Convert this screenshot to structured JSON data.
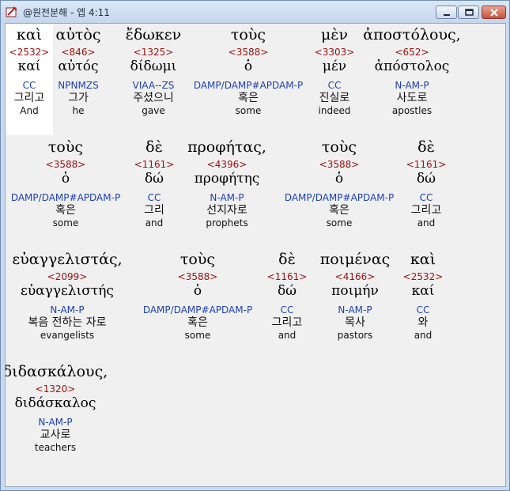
{
  "window": {
    "title": "@원전분해 - 엡 4:11",
    "colors": {
      "strong": "#a01010",
      "parse": "#1f3fb8",
      "highlight": "#ffffff"
    }
  },
  "rows": [
    {
      "words": [
        {
          "greek": "καὶ",
          "strong": "<2532>",
          "lemma": "καί",
          "parse": "CC",
          "korean": "그리고",
          "english": "And",
          "highlight": true
        },
        {
          "greek": "αὐτὸς",
          "strong": "<846>",
          "lemma": "αὐτός",
          "parse": "NPNMZS",
          "korean": "그가",
          "english": "he"
        },
        {
          "greek": "ἔδωκεν",
          "strong": "<1325>",
          "lemma": "δίδωμι",
          "parse": "VIAA--ZS",
          "korean": "주셨으니",
          "english": "gave"
        },
        {
          "greek": "τοὺς",
          "strong": "<3588>",
          "lemma": "ὁ",
          "parse": "DAMP/DAMP#APDAM-P",
          "korean": "혹은",
          "english": "some"
        },
        {
          "greek": "μὲν",
          "strong": "<3303>",
          "lemma": "μέν",
          "parse": "CC",
          "korean": "진실로",
          "english": "indeed"
        },
        {
          "greek": "ἀποστόλους,",
          "strong": "<652>",
          "lemma": "ἀπόστολος",
          "parse": "N-AM-P",
          "korean": "사도로",
          "english": "apostles"
        }
      ]
    },
    {
      "words": [
        {
          "greek": "τοὺς",
          "strong": "<3588>",
          "lemma": "ὁ",
          "parse": "DAMP/DAMP#APDAM-P",
          "korean": "혹은",
          "english": "some"
        },
        {
          "greek": "δὲ",
          "strong": "<1161>",
          "lemma": "δώ",
          "parse": "CC",
          "korean": "그리",
          "english": "and"
        },
        {
          "greek": "προφήτας,",
          "strong": "<4396>",
          "lemma": "προφήτης",
          "parse": "N-AM-P",
          "korean": "선지자로",
          "english": "prophets"
        },
        {
          "greek": "τοὺς",
          "strong": "<3588>",
          "lemma": "ὁ",
          "parse": "DAMP/DAMP#APDAM-P",
          "korean": "혹은",
          "english": "some"
        },
        {
          "greek": "δὲ",
          "strong": "<1161>",
          "lemma": "δώ",
          "parse": "CC",
          "korean": "그리고",
          "english": "and"
        }
      ]
    },
    {
      "words": [
        {
          "greek": "εὐαγγελιστάς,",
          "strong": "<2099>",
          "lemma": "εὐαγγελιστής",
          "parse": "N-AM-P",
          "korean": "복음 전하는 자로",
          "english": "evangelists"
        },
        {
          "greek": "τοὺς",
          "strong": "<3588>",
          "lemma": "ὁ",
          "parse": "DAMP/DAMP#APDAM-P",
          "korean": "혹은",
          "english": "some"
        },
        {
          "greek": "δὲ",
          "strong": "<1161>",
          "lemma": "δώ",
          "parse": "CC",
          "korean": "그리고",
          "english": "and"
        },
        {
          "greek": "ποιμένας",
          "strong": "<4166>",
          "lemma": "ποιμήν",
          "parse": "N-AM-P",
          "korean": "목사",
          "english": "pastors"
        },
        {
          "greek": "καὶ",
          "strong": "<2532>",
          "lemma": "καί",
          "parse": "CC",
          "korean": "와",
          "english": "and"
        }
      ]
    },
    {
      "words": [
        {
          "greek": "διδασκάλους,",
          "strong": "<1320>",
          "lemma": "διδάσκαλος",
          "parse": "N-AM-P",
          "korean": "교사로",
          "english": "teachers"
        }
      ]
    }
  ]
}
